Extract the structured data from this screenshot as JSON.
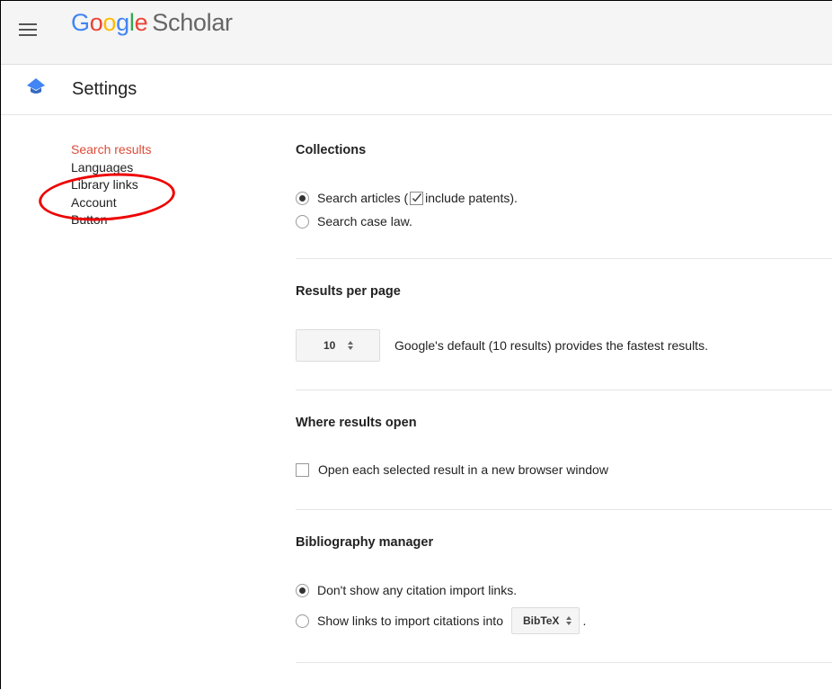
{
  "header": {
    "logo_letters": [
      "G",
      "o",
      "o",
      "g",
      "l",
      "e"
    ],
    "logo_suffix": "Scholar"
  },
  "settings_bar": {
    "title": "Settings"
  },
  "sidebar": {
    "items": [
      {
        "label": "Search results",
        "active": true
      },
      {
        "label": "Languages",
        "active": false
      },
      {
        "label": "Library links",
        "active": false
      },
      {
        "label": "Account",
        "active": false
      },
      {
        "label": "Button",
        "active": false
      }
    ]
  },
  "collections": {
    "title": "Collections",
    "option1_before": "Search articles (",
    "option1_after": " include patents).",
    "option2": "Search case law.",
    "selected": "search-articles",
    "include_patents": true
  },
  "results_per_page": {
    "title": "Results per page",
    "value": "10",
    "note": "Google's default (10 results) provides the fastest results."
  },
  "where_results_open": {
    "title": "Where results open",
    "checkbox_label": "Open each selected result in a new browser window",
    "checked": false
  },
  "bibliography": {
    "title": "Bibliography manager",
    "option1": "Don't show any citation import links.",
    "option2": "Show links to import citations into",
    "format": "BibTeX",
    "option2_suffix": ".",
    "selected": "none"
  },
  "colors": {
    "active_nav": "#dd4b39",
    "annotation_circle": "#ee0000"
  },
  "icons": {
    "menu": "hamburger-icon",
    "settings": "graduation-cap-icon"
  }
}
